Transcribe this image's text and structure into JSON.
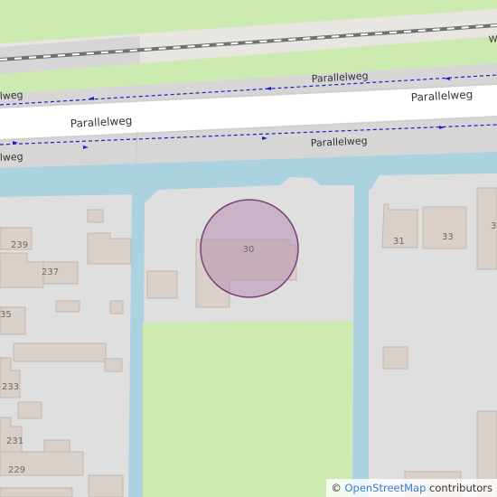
{
  "map": {
    "colors": {
      "background": "#e0dfdf",
      "water": "#aad3df",
      "grass": "#cdebb0",
      "road": "#ffffff",
      "road_casing": "#d0d0d0",
      "sidewalk": "#d6d6d6",
      "building": "#d9d0c9",
      "building_outline": "#c4b6ab",
      "rail": "#707070",
      "path_dashed": "#2020c8",
      "marker_fill": "#b58fb1",
      "marker_stroke": "#7b3e78"
    },
    "street_labels": [
      {
        "text": "Parallelweg"
      },
      {
        "text": "Parallelweg"
      },
      {
        "text": "Parallelweg"
      },
      {
        "text": "Parallelweg"
      },
      {
        "text": "lweg"
      },
      {
        "text": "lweg"
      },
      {
        "text": "W"
      }
    ],
    "house_numbers": [
      {
        "text": "239"
      },
      {
        "text": "237"
      },
      {
        "text": "35"
      },
      {
        "text": "233"
      },
      {
        "text": "231"
      },
      {
        "text": "229"
      },
      {
        "text": "30"
      },
      {
        "text": "31"
      },
      {
        "text": "33"
      },
      {
        "text": "3"
      }
    ],
    "marker": {
      "label": "30"
    }
  },
  "attribution": {
    "prefix": "© ",
    "link": "OpenStreetMap",
    "suffix": " contributors"
  }
}
